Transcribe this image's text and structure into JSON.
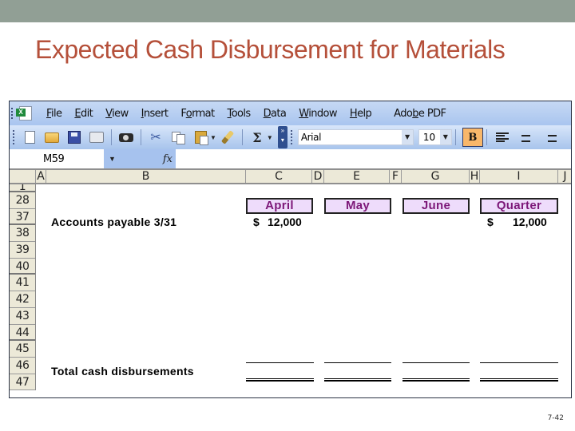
{
  "slide": {
    "title": "Expected Cash Disbursement for Materials",
    "slide_number": "7-42"
  },
  "excel": {
    "menu": [
      {
        "label": "File",
        "accel": "F",
        "rest": "ile"
      },
      {
        "label": "Edit",
        "accel": "E",
        "rest": "dit"
      },
      {
        "label": "View",
        "accel": "V",
        "rest": "iew"
      },
      {
        "label": "Insert",
        "accel": "I",
        "rest": "nsert"
      },
      {
        "label": "Format",
        "pre": "F",
        "accel": "o",
        "rest": "rmat"
      },
      {
        "label": "Tools",
        "accel": "T",
        "rest": "ools"
      },
      {
        "label": "Data",
        "accel": "D",
        "rest": "ata"
      },
      {
        "label": "Window",
        "accel": "W",
        "rest": "indow"
      },
      {
        "label": "Help",
        "accel": "H",
        "rest": "elp"
      },
      {
        "label": "Adobe PDF",
        "pre": "Ado",
        "accel": "b",
        "rest": "e PDF"
      }
    ],
    "toolbar": {
      "icons": [
        "new-icon",
        "open-icon",
        "save-icon",
        "print-icon",
        "research-icon",
        "cut-icon",
        "copy-icon",
        "paste-icon",
        "format-painter-icon",
        "autosum-icon"
      ],
      "autosum_glyph": "Σ",
      "font_name": "Arial",
      "font_size": "10",
      "bold_label": "B",
      "bold_active": true
    },
    "formula_bar": {
      "name_box": "M59",
      "fx_label": "fx",
      "formula": ""
    },
    "columns": [
      "A",
      "B",
      "C",
      "D",
      "E",
      "F",
      "G",
      "H",
      "I",
      "J"
    ],
    "rows": [
      "1",
      "28",
      "37",
      "38",
      "39",
      "40",
      "41",
      "42",
      "43",
      "44",
      "45",
      "46",
      "47"
    ],
    "headers": {
      "april": "April",
      "may": "May",
      "june": "June",
      "quarter": "Quarter"
    },
    "rows_data": {
      "accounts_payable": {
        "label": "Accounts payable 3/31",
        "april_currency": "$",
        "april_value": "12,000",
        "quarter_currency": "$",
        "quarter_value": "12,000"
      },
      "total": {
        "label": "Total cash disbursements"
      }
    },
    "colors": {
      "header_fill": "#eedcfb",
      "header_text": "#7c1778",
      "title": "#b5503a"
    }
  }
}
